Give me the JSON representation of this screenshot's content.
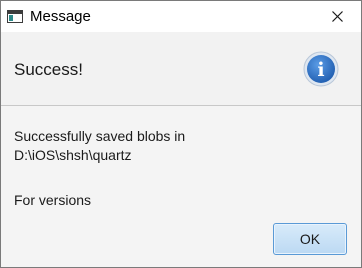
{
  "window": {
    "title": "Message",
    "icon": "window-app-icon",
    "close_icon": "close-icon"
  },
  "header": {
    "text": "Success!",
    "icon": "info-icon",
    "icon_glyph": "i",
    "icon_color": "#2f73c9"
  },
  "content": {
    "lines": [
      "Successfully saved blobs in",
      "D:\\iOS\\shsh\\quartz",
      "For versions"
    ]
  },
  "buttons": {
    "ok_label": "OK",
    "ok_color": "#c9e2f7"
  }
}
